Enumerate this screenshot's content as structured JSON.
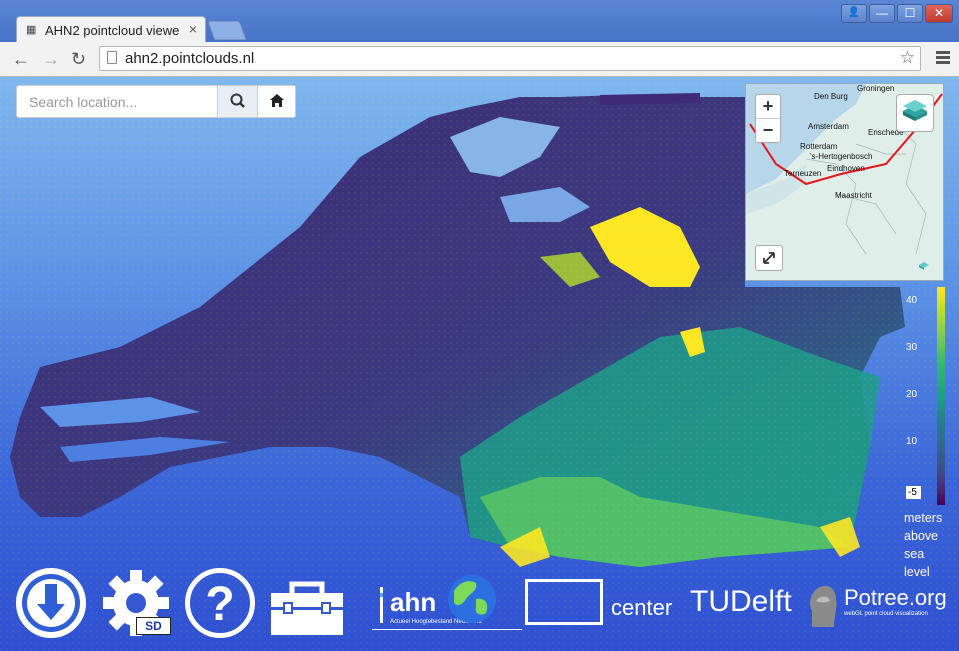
{
  "browser": {
    "tab_title": "AHN2 pointcloud viewe",
    "tab_close": "×",
    "url": "ahn2.pointclouds.nl",
    "back_glyph": "←",
    "forward_glyph": "→",
    "reload_glyph": "↻",
    "star_glyph": "☆",
    "window_buttons": {
      "profile": "👤",
      "minimize": "—",
      "maximize": "☐",
      "close": "✕"
    }
  },
  "search": {
    "placeholder": "Search location...",
    "search_icon": "search-icon",
    "home_icon": "home-icon"
  },
  "minimap": {
    "zoom_in": "+",
    "zoom_out": "−",
    "cities": [
      "Den Burg",
      "Groningen",
      "Amsterdam",
      "Enschede",
      "Rotterdam",
      "'s-Hertogenbosch",
      "Eindhoven",
      "Terneuzen",
      "Maastricht"
    ],
    "boundary_color": "#e8141a"
  },
  "legend": {
    "ticks": [
      "40",
      "30",
      "20",
      "10",
      "-5"
    ],
    "unit_lines": [
      "meters",
      "above",
      "sea",
      "level"
    ],
    "colors": [
      "#fde725",
      "#35b779",
      "#26828e",
      "#3e4989",
      "#440154"
    ]
  },
  "toolbar": {
    "download_icon": "download-icon",
    "settings_icon": "gear-icon",
    "settings_badge": "SD",
    "help_icon": "question-icon",
    "toolbox_icon": "toolbox-icon"
  },
  "logos": {
    "ahn": "ahn",
    "ahn_sub": "Actueel Hoogtebestand Nederland",
    "escience": "center",
    "tudelft": "TUDelft",
    "potree": "Potree.org",
    "potree_sub": "webGL point cloud visualization"
  }
}
